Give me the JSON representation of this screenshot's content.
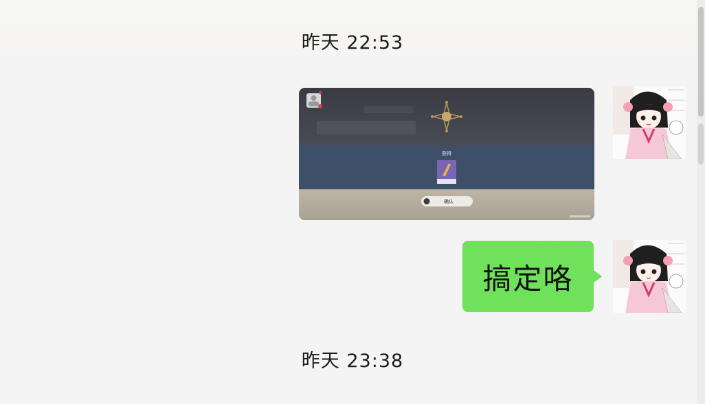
{
  "messages": [
    {
      "type": "timestamp",
      "text": "昨天 22:53"
    },
    {
      "type": "image",
      "sender": "self",
      "content": {
        "item_caption": "获得",
        "confirm_label": "确认"
      }
    },
    {
      "type": "text",
      "sender": "self",
      "text": "搞定咯"
    },
    {
      "type": "timestamp",
      "text": "昨天 23:38"
    }
  ],
  "colors": {
    "bubble_green": "#6fe15a",
    "background": "#f4f4f4"
  },
  "icons": {
    "avatar": "anime-girl-avatar-icon",
    "game_emblem": "star-emblem-icon",
    "game_item": "weapon-card-icon"
  }
}
